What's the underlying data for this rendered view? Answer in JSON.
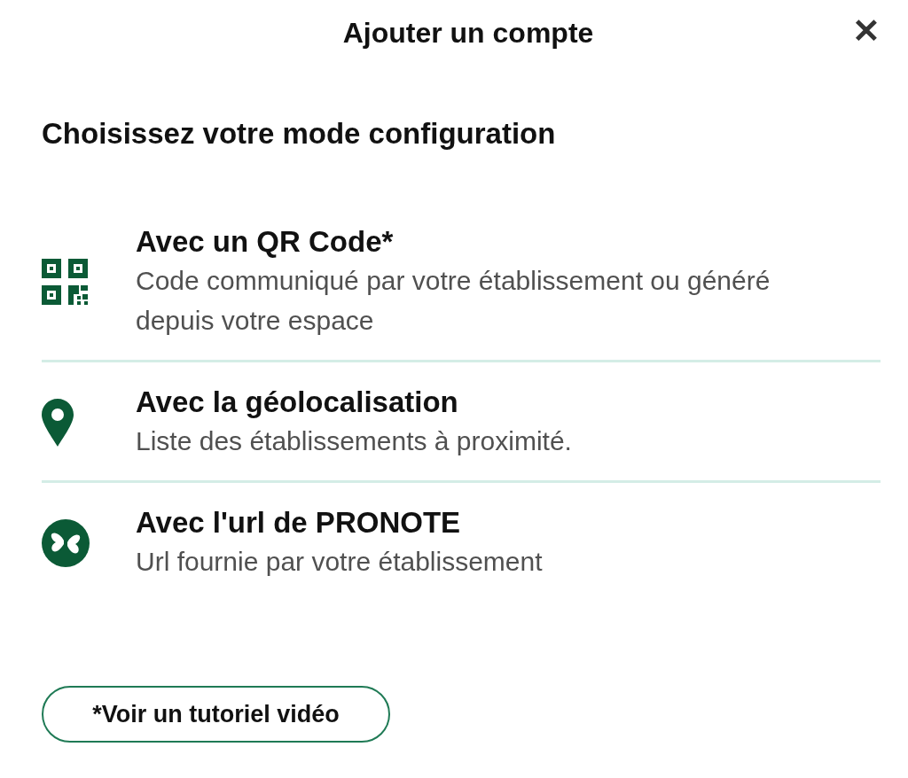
{
  "header": {
    "title": "Ajouter un compte",
    "close": "✕"
  },
  "heading": "Choisissez votre mode configuration",
  "options": [
    {
      "kind": "qr",
      "title": "Avec un QR Code*",
      "description": "Code communiqué par votre établissement ou généré depuis votre espace"
    },
    {
      "kind": "location",
      "title": "Avec la géolocalisation",
      "description": "Liste des établissements à proximité."
    },
    {
      "kind": "logo",
      "title": "Avec l'url de PRONOTE",
      "description": "Url fournie par votre établissement"
    }
  ],
  "tutorial_button": "*Voir un tutoriel vidéo"
}
